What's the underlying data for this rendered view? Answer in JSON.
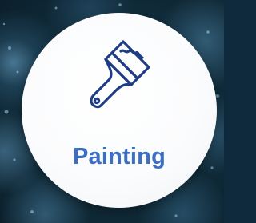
{
  "card": {
    "title": "Painting",
    "icon": "paintbrush-icon"
  },
  "colors": {
    "background": "#0f2a3c",
    "card": "#ffffff",
    "title": "#3a6fc4",
    "icon_stroke": "#1f3d86"
  }
}
